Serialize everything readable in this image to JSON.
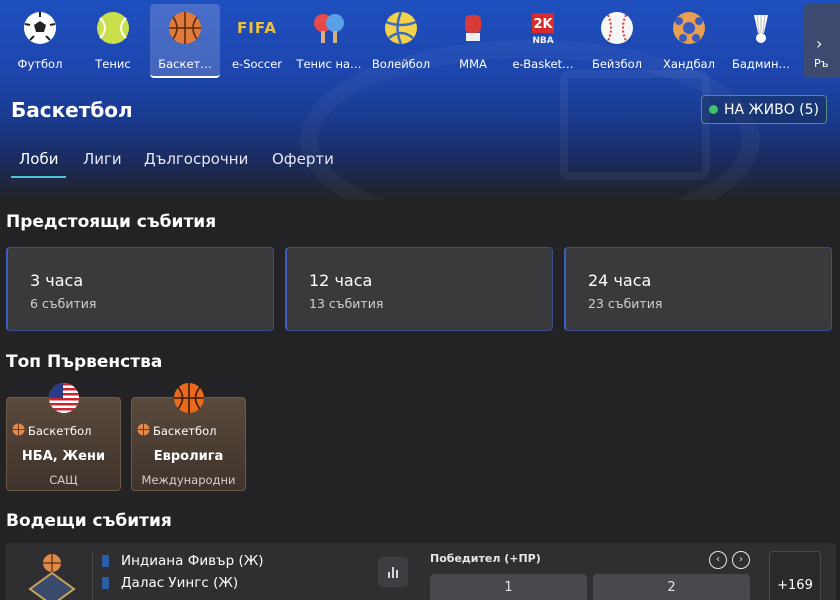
{
  "sports": [
    {
      "label": "Футбол",
      "icon": "soccer-ball-icon"
    },
    {
      "label": "Тенис",
      "icon": "tennis-ball-icon"
    },
    {
      "label": "Баскет…",
      "icon": "basketball-icon"
    },
    {
      "label": "e-Soccer",
      "icon": "fifa-icon"
    },
    {
      "label": "Тенис на…",
      "icon": "table-tennis-icon"
    },
    {
      "label": "Волейбол",
      "icon": "volleyball-icon"
    },
    {
      "label": "MMA",
      "icon": "boxing-glove-icon"
    },
    {
      "label": "e-Basket…",
      "icon": "nba2k-icon"
    },
    {
      "label": "Бейзбол",
      "icon": "baseball-icon"
    },
    {
      "label": "Хандбал",
      "icon": "handball-icon"
    },
    {
      "label": "Бадмин…",
      "icon": "shuttlecock-icon"
    },
    {
      "label": "Ръ",
      "icon": "chevron-right-icon"
    }
  ],
  "fifa_text": "FIFA",
  "nba_text": "NBA",
  "header": {
    "title": "Баскетбол",
    "live_label": "НА ЖИВО (5)"
  },
  "tabs": [
    "Лоби",
    "Лиги",
    "Дългосрочни",
    "Оферти"
  ],
  "upcoming": {
    "title": "Предстоящи събития",
    "cards": [
      {
        "time": "3 часа",
        "events": "6 събития"
      },
      {
        "time": "12 часа",
        "events": "13 събития"
      },
      {
        "time": "24 часа",
        "events": "23 събития"
      }
    ]
  },
  "top_leagues": {
    "title": "Топ Първенства",
    "cards": [
      {
        "sport": "Баскетбол",
        "name": "НБА, Жени",
        "country": "САЩ",
        "flag": "us-flag-icon"
      },
      {
        "sport": "Баскетбол",
        "name": "Евролига",
        "country": "Международни",
        "flag": "euroleague-icon"
      }
    ]
  },
  "leading": {
    "title": "Водещи събития",
    "event": {
      "team1": "Индиана Фивър (Ж)",
      "team2": "Далас Уингс (Ж)",
      "market": "Победител (+ПР)",
      "odd1": "1",
      "odd2": "2",
      "more": "+169"
    }
  },
  "colors": {
    "accent": "#4fc3d8",
    "live_dot": "#3ec26a",
    "hero": "#1f4fbf",
    "background": "#232325"
  }
}
